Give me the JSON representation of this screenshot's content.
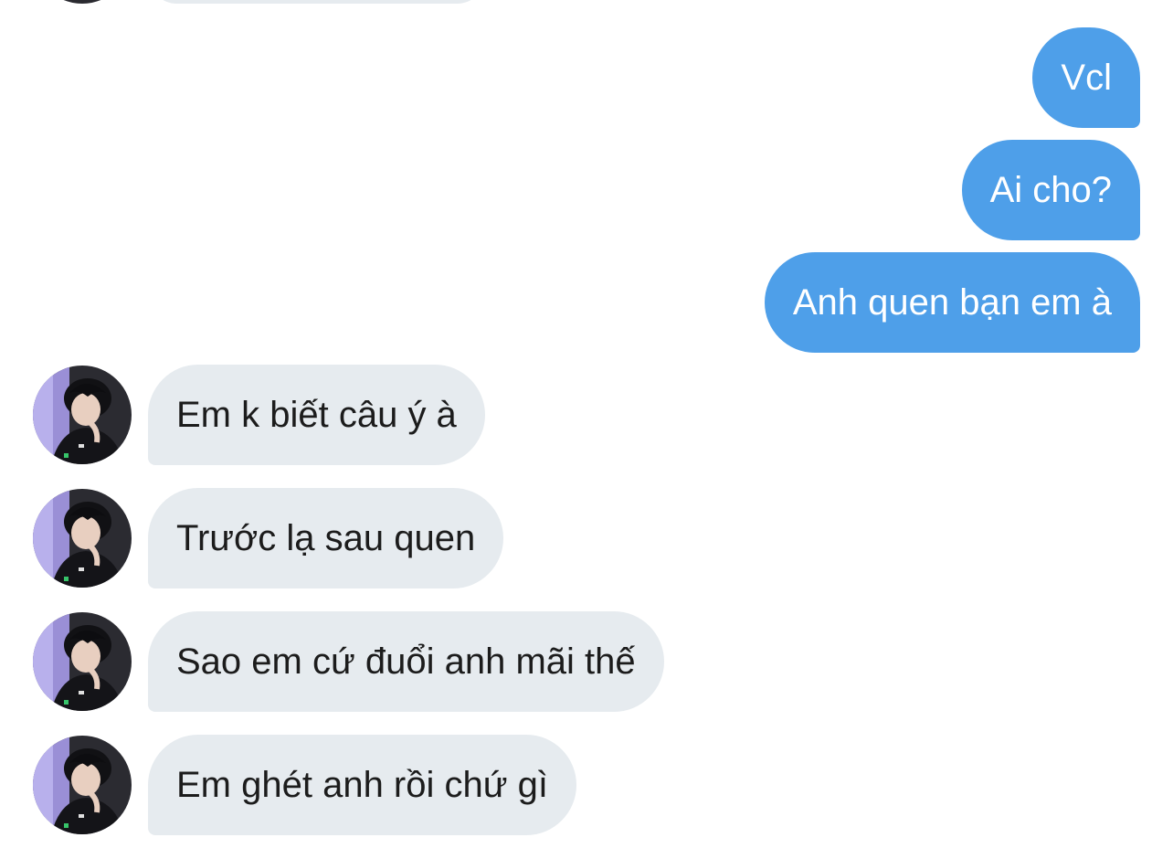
{
  "conversation": {
    "outgoing": [
      {
        "text": "Vcl"
      },
      {
        "text": "Ai cho?"
      },
      {
        "text": "Anh quen bạn em à"
      }
    ],
    "incoming": [
      {
        "text": "Em k biết câu ý à"
      },
      {
        "text": "Trước lạ sau quen"
      },
      {
        "text": "Sao em cứ đuổi anh mãi thế"
      },
      {
        "text": "Em ghét anh rồi chứ gì"
      }
    ]
  },
  "colors": {
    "outgoing_bubble": "#4e9fe9",
    "incoming_bubble": "#e6ebef",
    "background": "#ffffff",
    "incoming_text": "#1c1c1c",
    "outgoing_text": "#ffffff"
  },
  "icons": {
    "avatar": "contact-avatar"
  }
}
